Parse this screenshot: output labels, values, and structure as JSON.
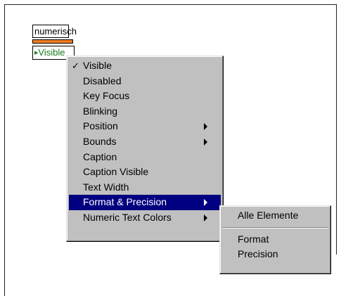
{
  "control": {
    "label": "numerisch",
    "node_text": "Visible",
    "bar_color": "#f07d20",
    "node_text_color": "#1a7a1a"
  },
  "context_menu": {
    "items": [
      {
        "label": "Visible",
        "checked": true
      },
      {
        "label": "Disabled"
      },
      {
        "label": "Key Focus"
      },
      {
        "label": "Blinking"
      },
      {
        "label": "Position",
        "submenu": true
      },
      {
        "label": "Bounds",
        "submenu": true
      },
      {
        "label": "Caption"
      },
      {
        "label": "Caption Visible"
      },
      {
        "label": "Text Width"
      },
      {
        "label": "Format & Precision",
        "submenu": true,
        "highlighted": true
      },
      {
        "label": "Numeric Text Colors",
        "submenu": true
      }
    ],
    "check_glyph": "✓",
    "highlight_color": "#000080"
  },
  "submenu": {
    "items": [
      {
        "label": "Alle Elemente"
      },
      {
        "label": "Format"
      },
      {
        "label": "Precision"
      }
    ]
  }
}
